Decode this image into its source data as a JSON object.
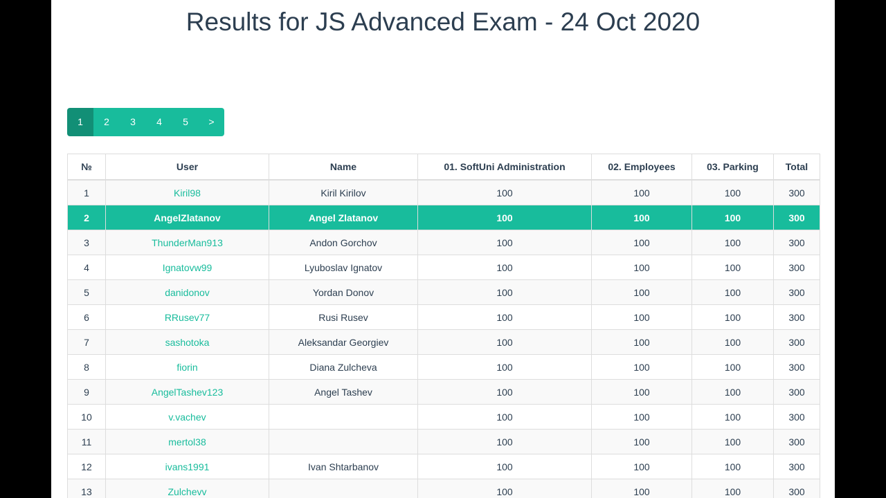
{
  "title": "Results for JS Advanced Exam - 24 Oct 2020",
  "pagination": {
    "pages": [
      "1",
      "2",
      "3",
      "4",
      "5"
    ],
    "next": ">",
    "active": "1"
  },
  "table": {
    "headers": [
      "№",
      "User",
      "Name",
      "01. SoftUni Administration",
      "02. Employees",
      "03. Parking",
      "Total"
    ],
    "rows": [
      {
        "no": "1",
        "user": "Kiril98",
        "name": "Kiril Kirilov",
        "p1": "100",
        "p2": "100",
        "p3": "100",
        "total": "300"
      },
      {
        "no": "2",
        "user": "AngelZlatanov",
        "name": "Angel Zlatanov",
        "p1": "100",
        "p2": "100",
        "p3": "100",
        "total": "300",
        "highlighted": true
      },
      {
        "no": "3",
        "user": "ThunderMan913",
        "name": "Andon Gorchov",
        "p1": "100",
        "p2": "100",
        "p3": "100",
        "total": "300"
      },
      {
        "no": "4",
        "user": "Ignatovw99",
        "name": "Lyuboslav Ignatov",
        "p1": "100",
        "p2": "100",
        "p3": "100",
        "total": "300"
      },
      {
        "no": "5",
        "user": "danidonov",
        "name": "Yordan Donov",
        "p1": "100",
        "p2": "100",
        "p3": "100",
        "total": "300"
      },
      {
        "no": "6",
        "user": "RRusev77",
        "name": "Rusi Rusev",
        "p1": "100",
        "p2": "100",
        "p3": "100",
        "total": "300"
      },
      {
        "no": "7",
        "user": "sashotoka",
        "name": "Aleksandar Georgiev",
        "p1": "100",
        "p2": "100",
        "p3": "100",
        "total": "300"
      },
      {
        "no": "8",
        "user": "fiorin",
        "name": "Diana Zulcheva",
        "p1": "100",
        "p2": "100",
        "p3": "100",
        "total": "300"
      },
      {
        "no": "9",
        "user": "AngelTashev123",
        "name": "Angel Tashev",
        "p1": "100",
        "p2": "100",
        "p3": "100",
        "total": "300"
      },
      {
        "no": "10",
        "user": "v.vachev",
        "name": "",
        "p1": "100",
        "p2": "100",
        "p3": "100",
        "total": "300"
      },
      {
        "no": "11",
        "user": "mertol38",
        "name": "",
        "p1": "100",
        "p2": "100",
        "p3": "100",
        "total": "300"
      },
      {
        "no": "12",
        "user": "ivans1991",
        "name": "Ivan Shtarbanov",
        "p1": "100",
        "p2": "100",
        "p3": "100",
        "total": "300"
      },
      {
        "no": "13",
        "user": "Zulchevv",
        "name": "",
        "p1": "100",
        "p2": "100",
        "p3": "100",
        "total": "300"
      }
    ]
  },
  "colors": {
    "accent": "#18bc9c",
    "accent_active": "#128f76",
    "text": "#2c3e50"
  }
}
